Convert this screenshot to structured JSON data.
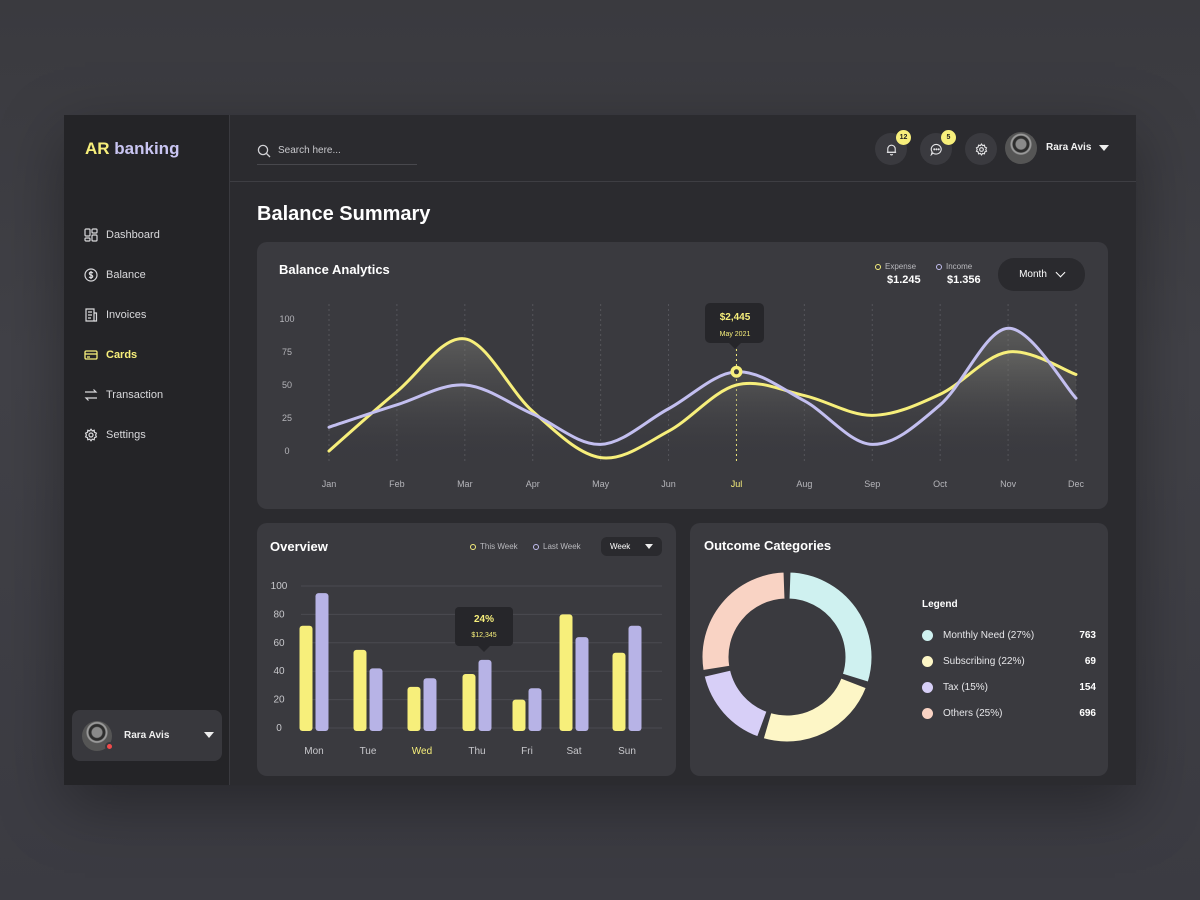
{
  "brand": {
    "prefix": "AR",
    "name": " banking"
  },
  "sidebar": {
    "items": [
      {
        "label": "Dashboard",
        "icon": "dashboard-icon"
      },
      {
        "label": "Balance",
        "icon": "dollar-icon"
      },
      {
        "label": "Invoices",
        "icon": "invoice-icon"
      },
      {
        "label": "Cards",
        "icon": "card-icon",
        "active": true
      },
      {
        "label": "Transaction",
        "icon": "transfer-icon"
      },
      {
        "label": "Settings",
        "icon": "gear-icon"
      }
    ],
    "profile_name": "Rara Avis"
  },
  "topbar": {
    "search_placeholder": "Search here...",
    "notifications_count": "12",
    "messages_count": "5",
    "user_name": "Rara Avis"
  },
  "page_title": "Balance Summary",
  "colors": {
    "yellow": "#f7ef7b",
    "lavender": "#c3bff0",
    "mint": "#cff1f0",
    "cream": "#fdf6c6",
    "lilac": "#d7cff7",
    "peach": "#f9d3c4"
  },
  "balance": {
    "title": "Balance Analytics",
    "expense_label": "Expense",
    "expense_value": "$1.245",
    "income_label": "Income",
    "income_value": "$1.356",
    "period": "Month",
    "tooltip_value": "$2,445",
    "tooltip_date": "May 2021"
  },
  "overview": {
    "title": "Overview",
    "this_week": "This Week",
    "last_week": "Last Week",
    "period": "Week",
    "tooltip_pct": "24%",
    "tooltip_value": "$12,345"
  },
  "outcome": {
    "title": "Outcome Categories",
    "legend_title": "Legend",
    "items": [
      {
        "label": "Monthly Need (27%)",
        "value": "763",
        "color": "#cff1f0"
      },
      {
        "label": "Subscribing (22%)",
        "value": "69",
        "color": "#fdf6c6"
      },
      {
        "label": "Tax (15%)",
        "value": "154",
        "color": "#d7cff7"
      },
      {
        "label": "Others (25%)",
        "value": "696",
        "color": "#f9d3c4"
      }
    ]
  },
  "chart_data": [
    {
      "type": "line",
      "title": "Balance Analytics",
      "x": [
        "Jan",
        "Feb",
        "Mar",
        "Apr",
        "May",
        "Jun",
        "Jul",
        "Aug",
        "Sep",
        "Oct",
        "Nov",
        "Dec"
      ],
      "highlight_x": "Jul",
      "ylim": [
        0,
        100
      ],
      "yticks": [
        0,
        25,
        50,
        75,
        100
      ],
      "series": [
        {
          "name": "Expense",
          "color": "#f7ef7b",
          "values": [
            0,
            45,
            85,
            30,
            -5,
            15,
            50,
            42,
            27,
            43,
            75,
            58
          ]
        },
        {
          "name": "Income",
          "color": "#c3bff0",
          "values": [
            18,
            35,
            50,
            28,
            5,
            32,
            60,
            38,
            5,
            35,
            93,
            40
          ]
        }
      ]
    },
    {
      "type": "bar",
      "title": "Overview",
      "categories": [
        "Mon",
        "Tue",
        "Wed",
        "Thu",
        "Fri",
        "Sat",
        "Sun"
      ],
      "highlight": "Wed",
      "ylim": [
        0,
        100
      ],
      "yticks": [
        0,
        20,
        40,
        60,
        80,
        100
      ],
      "series": [
        {
          "name": "This Week",
          "color": "#f7ef7b",
          "values": [
            72,
            55,
            29,
            38,
            20,
            80,
            53
          ]
        },
        {
          "name": "Last Week",
          "color": "#b7b3e6",
          "values": [
            95,
            42,
            35,
            48,
            28,
            64,
            72
          ]
        }
      ]
    },
    {
      "type": "pie",
      "title": "Outcome Categories",
      "labels": [
        "Monthly Need",
        "Subscribing",
        "Tax",
        "Others"
      ],
      "values": [
        27,
        22,
        15,
        25
      ],
      "colors": [
        "#cff1f0",
        "#fdf6c6",
        "#d7cff7",
        "#f9d3c4"
      ]
    }
  ]
}
